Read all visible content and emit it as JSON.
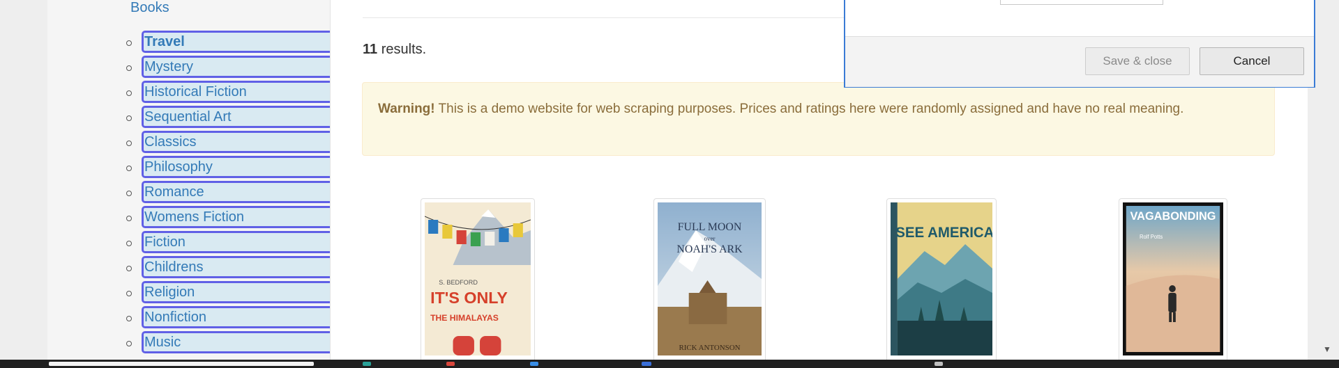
{
  "sidebar": {
    "books_label": "Books",
    "categories": [
      {
        "label": "Travel",
        "active": true
      },
      {
        "label": "Mystery"
      },
      {
        "label": "Historical Fiction"
      },
      {
        "label": "Sequential Art"
      },
      {
        "label": "Classics"
      },
      {
        "label": "Philosophy"
      },
      {
        "label": "Romance"
      },
      {
        "label": "Womens Fiction"
      },
      {
        "label": "Fiction"
      },
      {
        "label": "Childrens"
      },
      {
        "label": "Religion"
      },
      {
        "label": "Nonfiction"
      },
      {
        "label": "Music"
      }
    ]
  },
  "results": {
    "count": "11",
    "suffix": " results."
  },
  "warning": {
    "strong": "Warning!",
    "text": " This is a demo website for web scraping purposes. Prices and ratings here were randomly assigned and have no real meaning."
  },
  "books": [
    {
      "cover_lines": [
        "S. BEDFORD",
        "IT'S ONLY",
        "THE HIMALAYAS"
      ]
    },
    {
      "cover_lines": [
        "FULL MOON",
        "over",
        "NOAH'S ARK",
        "RICK ANTONSON"
      ]
    },
    {
      "cover_lines": [
        "SEE AMERICA"
      ]
    },
    {
      "cover_lines": [
        "VAGABONDING",
        "Rolf Potts"
      ]
    }
  ],
  "dialog": {
    "save_label": "Save & close",
    "cancel_label": "Cancel"
  },
  "colors": {
    "link": "#337ab7",
    "highlight_border": "#6060e6",
    "highlight_fill": "#d9eaf2",
    "warning_bg": "#fcf8e3",
    "warning_text": "#8a6d3b"
  }
}
